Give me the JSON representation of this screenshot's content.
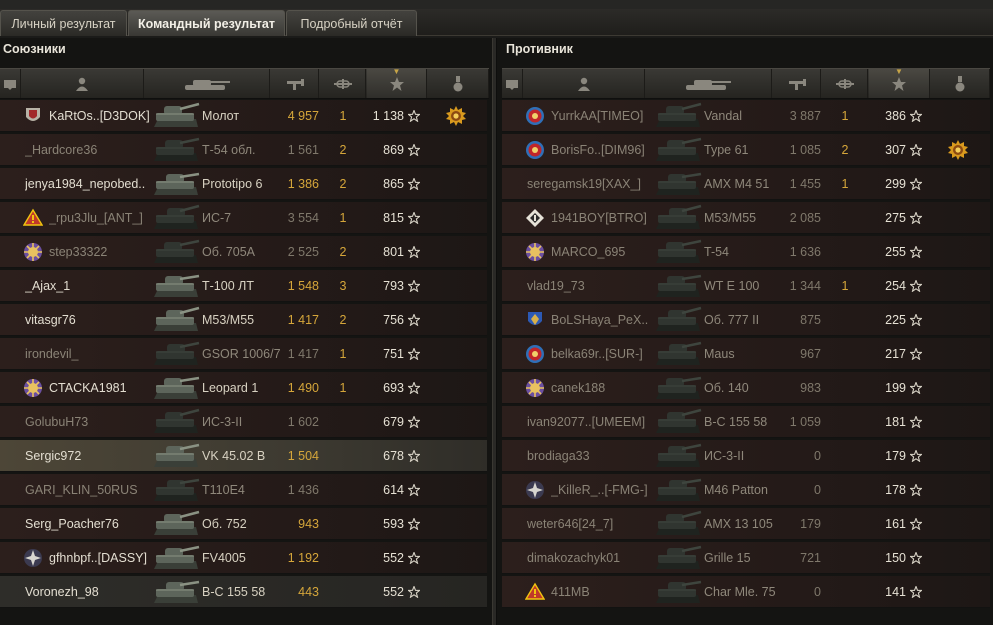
{
  "tabs": [
    {
      "label": "Личный результат",
      "active": false
    },
    {
      "label": "Командный результат",
      "active": true
    },
    {
      "label": "Подробный отчёт",
      "active": false
    }
  ],
  "allies": {
    "title": "Союзники",
    "rows": [
      {
        "player": "KaRtOs..[D3DOK]",
        "tank": "Молот",
        "damage": "4 957",
        "kills": "1",
        "xp": "1 138",
        "alive": true,
        "badge": "shield-red",
        "medal": true,
        "style": "rb"
      },
      {
        "player": "_Hardcore36",
        "tank": "Т-54 обл.",
        "damage": "1 561",
        "kills": "2",
        "xp": "869",
        "alive": false,
        "badge": "",
        "medal": false,
        "style": "rb"
      },
      {
        "player": "jenya1984_nepobed..",
        "tank": "Prototipo 6",
        "damage": "1 386",
        "kills": "2",
        "xp": "865",
        "alive": true,
        "badge": "",
        "medal": false,
        "style": "rb"
      },
      {
        "player": "_rpu3Jlu_[ANT_]",
        "tank": "ИС-7",
        "damage": "3 554",
        "kills": "1",
        "xp": "815",
        "alive": false,
        "badge": "triangle-red",
        "medal": false,
        "style": "rb"
      },
      {
        "player": "step33322",
        "tank": "Об. 705А",
        "damage": "2 525",
        "kills": "2",
        "xp": "801",
        "alive": false,
        "badge": "emblem-gold",
        "medal": false,
        "style": "rb"
      },
      {
        "player": "_Ajax_1",
        "tank": "Т-100 ЛТ",
        "damage": "1 548",
        "kills": "3",
        "xp": "793",
        "alive": true,
        "badge": "",
        "medal": false,
        "style": "rb"
      },
      {
        "player": "vitasgr76",
        "tank": "M53/M55",
        "damage": "1 417",
        "kills": "2",
        "xp": "756",
        "alive": true,
        "badge": "",
        "medal": false,
        "style": "rb"
      },
      {
        "player": "irondevil_",
        "tank": "GSOR 1006/7",
        "damage": "1 417",
        "kills": "1",
        "xp": "751",
        "alive": false,
        "badge": "",
        "medal": false,
        "style": "rb"
      },
      {
        "player": "CTACKA1981",
        "tank": "Leopard 1",
        "damage": "1 490",
        "kills": "1",
        "xp": "693",
        "alive": true,
        "badge": "emblem-gold",
        "medal": false,
        "style": "rb"
      },
      {
        "player": "GolubuH73",
        "tank": "ИС-3-II",
        "damage": "1 602",
        "kills": "",
        "xp": "679",
        "alive": false,
        "badge": "",
        "medal": false,
        "style": "rb"
      },
      {
        "player": "Sergic972",
        "tank": "VK 45.02 B",
        "damage": "1 504",
        "kills": "",
        "xp": "678",
        "alive": true,
        "badge": "",
        "medal": false,
        "style": "rs"
      },
      {
        "player": "GARI_KLIN_50RUS",
        "tank": "T110E4",
        "damage": "1 436",
        "kills": "",
        "xp": "614",
        "alive": false,
        "badge": "",
        "medal": false,
        "style": "rb"
      },
      {
        "player": "Serg_Poacher76",
        "tank": "Об. 752",
        "damage": "943",
        "kills": "",
        "xp": "593",
        "alive": true,
        "badge": "",
        "medal": false,
        "style": "rb"
      },
      {
        "player": "gfhnbpf..[DASSY]",
        "tank": "FV4005",
        "damage": "1 192",
        "kills": "",
        "xp": "552",
        "alive": true,
        "badge": "emblem-silver",
        "medal": false,
        "style": "rb"
      },
      {
        "player": "Voronezh_98",
        "tank": "В-С 155 58",
        "damage": "443",
        "kills": "",
        "xp": "552",
        "alive": true,
        "badge": "",
        "medal": false,
        "style": "rl"
      }
    ]
  },
  "enemies": {
    "title": "Противник",
    "rows": [
      {
        "player": "YurrkAA[TIMEO]",
        "tank": "Vandal",
        "damage": "3 887",
        "kills": "1",
        "xp": "386",
        "alive": false,
        "badge": "circle-red",
        "medal": false,
        "style": "rb"
      },
      {
        "player": "BorisFo..[DIM96]",
        "tank": "Type 61",
        "damage": "1 085",
        "kills": "2",
        "xp": "307",
        "alive": false,
        "badge": "circle-red",
        "medal": true,
        "style": "rb"
      },
      {
        "player": "seregamsk19[XAX_]",
        "tank": "AMX M4 51",
        "damage": "1 455",
        "kills": "1",
        "xp": "299",
        "alive": false,
        "badge": "",
        "medal": false,
        "style": "rb"
      },
      {
        "player": "1941BOY[BTRO]",
        "tank": "M53/M55",
        "damage": "2 085",
        "kills": "",
        "xp": "275",
        "alive": false,
        "badge": "diamond-white",
        "medal": false,
        "style": "rb"
      },
      {
        "player": "MARCO_695",
        "tank": "T-54",
        "damage": "1 636",
        "kills": "",
        "xp": "255",
        "alive": false,
        "badge": "emblem-gold",
        "medal": false,
        "style": "rb"
      },
      {
        "player": "vlad19_73",
        "tank": "WT E 100",
        "damage": "1 344",
        "kills": "1",
        "xp": "254",
        "alive": false,
        "badge": "",
        "medal": false,
        "style": "rb"
      },
      {
        "player": "BoLSHaya_PeX..",
        "tank": "Об. 777 II",
        "damage": "875",
        "kills": "",
        "xp": "225",
        "alive": false,
        "badge": "shield-blue",
        "medal": false,
        "style": "rb"
      },
      {
        "player": "belka69r..[SUR-]",
        "tank": "Maus",
        "damage": "967",
        "kills": "",
        "xp": "217",
        "alive": false,
        "badge": "circle-red",
        "medal": false,
        "style": "rb"
      },
      {
        "player": "canek188",
        "tank": "Об. 140",
        "damage": "983",
        "kills": "",
        "xp": "199",
        "alive": false,
        "badge": "emblem-gold",
        "medal": false,
        "style": "rb"
      },
      {
        "player": "ivan92077..[UMEEM]",
        "tank": "B-C 155 58",
        "damage": "1 059",
        "kills": "",
        "xp": "181",
        "alive": false,
        "badge": "",
        "medal": false,
        "style": "rb"
      },
      {
        "player": "brodiaga33",
        "tank": "ИС-3-II",
        "damage": "0",
        "kills": "",
        "xp": "179",
        "alive": false,
        "badge": "",
        "medal": false,
        "style": "rb"
      },
      {
        "player": "_KilleR_..[-FMG-]",
        "tank": "M46 Patton",
        "damage": "0",
        "kills": "",
        "xp": "178",
        "alive": false,
        "badge": "emblem-silver",
        "medal": false,
        "style": "rb"
      },
      {
        "player": "weter646[24_7]",
        "tank": "AMX 13 105",
        "damage": "179",
        "kills": "",
        "xp": "161",
        "alive": false,
        "badge": "",
        "medal": false,
        "style": "rb"
      },
      {
        "player": "dimakozachyk01",
        "tank": "Grille 15",
        "damage": "721",
        "kills": "",
        "xp": "150",
        "alive": false,
        "badge": "",
        "medal": false,
        "style": "rb"
      },
      {
        "player": "411MB",
        "tank": "Char Mle. 75",
        "damage": "0",
        "kills": "",
        "xp": "141",
        "alive": false,
        "badge": "triangle-red",
        "medal": false,
        "style": "rb"
      }
    ]
  },
  "header_icons": [
    "platoon-icon",
    "player-icon",
    "tank-icon",
    "damage-icon",
    "kills-icon",
    "xp-icon",
    "medal-icon"
  ],
  "colors": {
    "damage": "#d5a63a",
    "text": "#e3ded1",
    "dead_text": "#8a8376",
    "accent": "#c7a548"
  }
}
